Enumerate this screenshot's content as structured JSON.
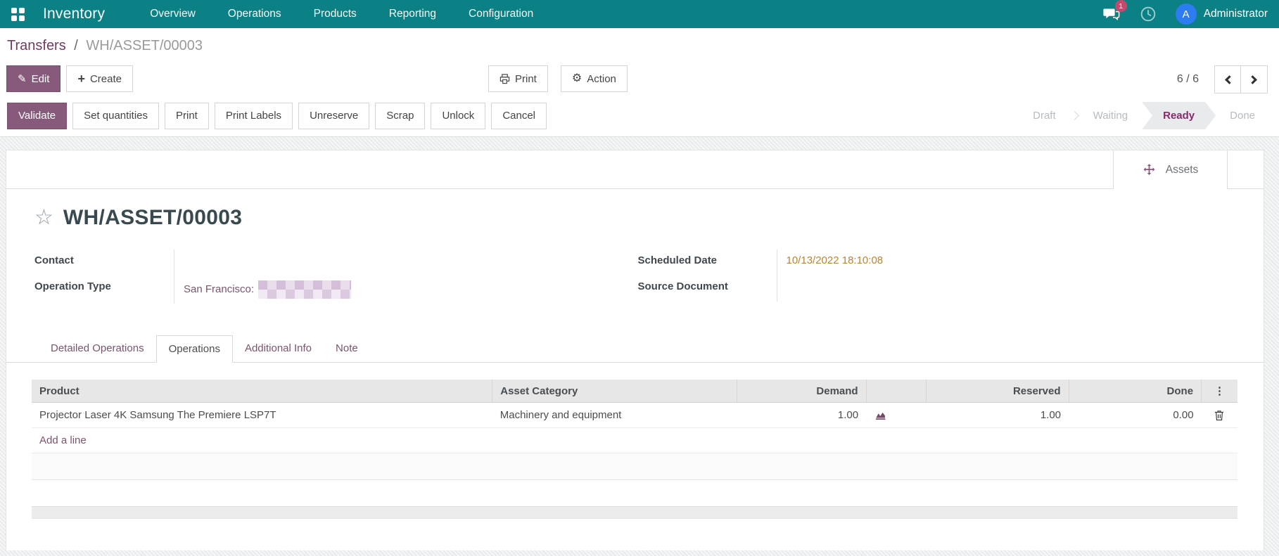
{
  "navbar": {
    "brand": "Inventory",
    "menu_items": [
      "Overview",
      "Operations",
      "Products",
      "Reporting",
      "Configuration"
    ],
    "messages_badge": "1",
    "user_initial": "A",
    "user_name": "Administrator"
  },
  "breadcrumb": {
    "parent": "Transfers",
    "separator": "/",
    "current": "WH/ASSET/00003"
  },
  "action_bar": {
    "edit": "Edit",
    "create": "Create",
    "print": "Print",
    "action": "Action",
    "pager": "6 / 6"
  },
  "status_bar": {
    "buttons": [
      "Validate",
      "Set quantities",
      "Print",
      "Print Labels",
      "Unreserve",
      "Scrap",
      "Unlock",
      "Cancel"
    ],
    "primary_button": "Validate",
    "states": [
      "Draft",
      "Waiting",
      "Ready",
      "Done"
    ],
    "active_state": "Ready"
  },
  "sheet": {
    "smart_button_label": "Assets",
    "title": "WH/ASSET/00003",
    "fields": {
      "contact_label": "Contact",
      "operation_type_label": "Operation Type",
      "operation_type_value": "San Francisco:",
      "scheduled_date_label": "Scheduled Date",
      "scheduled_date_value": "10/13/2022 18:10:08",
      "source_document_label": "Source Document"
    },
    "tabs": [
      "Detailed Operations",
      "Operations",
      "Additional Info",
      "Note"
    ],
    "active_tab": "Operations"
  },
  "table": {
    "headers": {
      "product": "Product",
      "asset_category": "Asset Category",
      "demand": "Demand",
      "reserved": "Reserved",
      "done": "Done"
    },
    "rows": [
      {
        "product": "Projector Laser 4K Samsung The Premiere LSP7T",
        "asset_category": "Machinery and equipment",
        "demand": "1.00",
        "reserved": "1.00",
        "done": "0.00"
      }
    ],
    "add_line": "Add a line"
  },
  "icons": {
    "star": "☆",
    "plus": "+",
    "gear": "⚙",
    "pencil": "✎",
    "kebab": "⋮"
  },
  "colors": {
    "navbar_teal": "#0c8185",
    "primary_purple": "#875a7b",
    "link_purple": "#7a546d",
    "ready_state_purple": "#872a6c",
    "scheduled_date_amber": "#b9852f",
    "badge_pink": "#c5496d",
    "avatar_blue": "#2e7cf2"
  }
}
